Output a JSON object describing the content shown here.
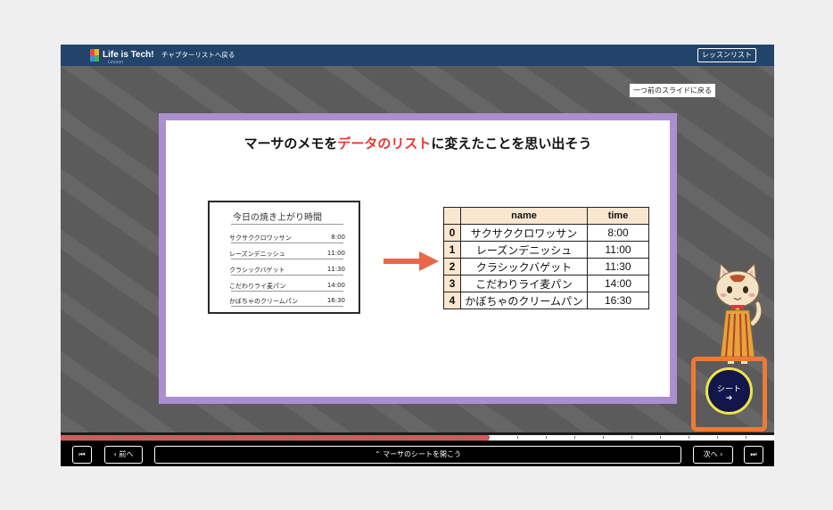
{
  "topbar": {
    "logo_text": "Life is Tech!",
    "logo_sub": "Lesson",
    "back_link": "チャプターリストへ戻る",
    "lesson_list": "レッスンリスト"
  },
  "stage": {
    "prev_slide": "一つ前のスライドに戻る"
  },
  "slide": {
    "title_pre": "マーサのメモを",
    "title_hl": "データのリスト",
    "title_post": "に変えたことを思い出そう",
    "accent_color": "#e53a2d",
    "memo": {
      "title": "今日の焼き上がり時間",
      "rows": [
        {
          "name": "サクサククロワッサン",
          "time": "8:00"
        },
        {
          "name": "レーズンデニッシュ",
          "time": "11:00"
        },
        {
          "name": "クラシックバゲット",
          "time": "11:30"
        },
        {
          "name": "こだわりライ麦パン",
          "time": "14:00"
        },
        {
          "name": "かぼちゃのクリームパン",
          "time": "16:30"
        }
      ]
    },
    "table": {
      "headers": [
        "",
        "name",
        "time"
      ],
      "rows": [
        [
          "0",
          "サクサククロワッサン",
          "8:00"
        ],
        [
          "1",
          "レーズンデニッシュ",
          "11:00"
        ],
        [
          "2",
          "クラシックバゲット",
          "11:30"
        ],
        [
          "3",
          "こだわりライ麦パン",
          "14:00"
        ],
        [
          "4",
          "かぼちゃのクリームパン",
          "16:30"
        ]
      ]
    }
  },
  "sheet_button": {
    "label": "シート",
    "arrow": "➔"
  },
  "progress": {
    "fraction": 0.6
  },
  "controls": {
    "first": "⏮",
    "prev": "‹  前へ",
    "center": "⌃  マーサのシートを開こう",
    "next": "次へ  ›",
    "last": "⏭"
  }
}
